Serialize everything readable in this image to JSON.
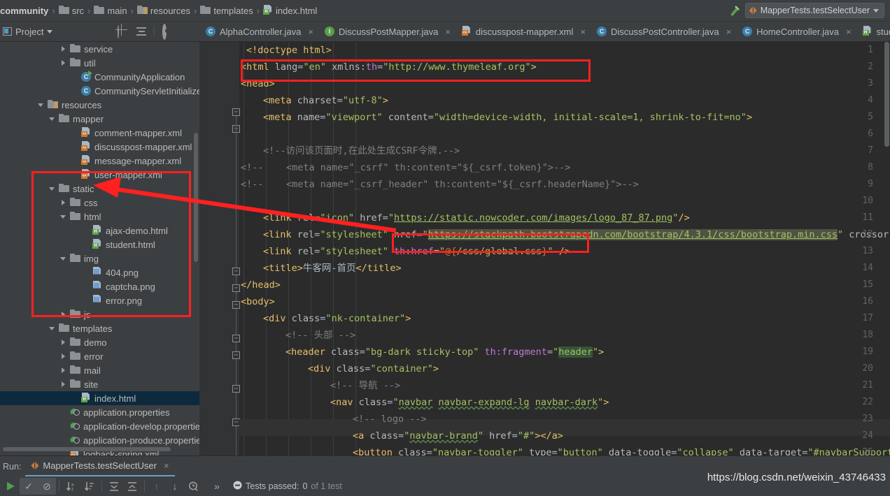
{
  "breadcrumb": {
    "items": [
      {
        "label": "community",
        "icon": "none",
        "bold": true
      },
      {
        "label": "src",
        "icon": "folder-icon"
      },
      {
        "label": "main",
        "icon": "folder-icon"
      },
      {
        "label": "resources",
        "icon": "resources-folder-icon"
      },
      {
        "label": "templates",
        "icon": "folder-icon"
      },
      {
        "label": "index.html",
        "icon": "html-file-icon"
      }
    ],
    "separator": "›"
  },
  "run_widget": {
    "hammer_tooltip": "make",
    "config_name": "MapperTests.testSelectUser",
    "caret": "▼"
  },
  "project_panel": {
    "title": "Project",
    "caret": "▼",
    "tools": [
      "locate-icon",
      "collapse-all-icon",
      "settings-gear-icon",
      "hide-icon"
    ]
  },
  "editor_tabs": [
    {
      "label": "AlphaController.java",
      "icon": "java-class-icon",
      "close": "×"
    },
    {
      "label": "DiscussPostMapper.java",
      "icon": "java-interface-icon",
      "close": "×"
    },
    {
      "label": "discusspost-mapper.xml",
      "icon": "xml-file-icon",
      "close": "×"
    },
    {
      "label": "DiscussPostController.java",
      "icon": "java-class-icon",
      "close": "×"
    },
    {
      "label": "HomeController.java",
      "icon": "java-class-icon",
      "close": "×"
    },
    {
      "label": "student",
      "icon": "html-file-icon",
      "close": "×"
    }
  ],
  "tree": [
    {
      "label": "service",
      "indent": 5,
      "arrow": "right",
      "icon": "folder-icon"
    },
    {
      "label": "util",
      "indent": 5,
      "arrow": "right",
      "icon": "folder-icon"
    },
    {
      "label": "CommunityApplication",
      "indent": 6,
      "arrow": "none",
      "icon": "spring-app-icon"
    },
    {
      "label": "CommunityServletInitializer",
      "indent": 6,
      "arrow": "none",
      "icon": "java-class-icon"
    },
    {
      "label": "resources",
      "indent": 3,
      "arrow": "down",
      "icon": "resources-folder-icon"
    },
    {
      "label": "mapper",
      "indent": 4,
      "arrow": "down",
      "icon": "folder-icon"
    },
    {
      "label": "comment-mapper.xml",
      "indent": 6,
      "arrow": "none",
      "icon": "xml-file-icon"
    },
    {
      "label": "discusspost-mapper.xml",
      "indent": 6,
      "arrow": "none",
      "icon": "xml-file-icon"
    },
    {
      "label": "message-mapper.xml",
      "indent": 6,
      "arrow": "none",
      "icon": "xml-file-icon"
    },
    {
      "label": "user-mapper.xml",
      "indent": 6,
      "arrow": "none",
      "icon": "xml-file-icon"
    },
    {
      "label": "static",
      "indent": 4,
      "arrow": "down",
      "icon": "folder-icon"
    },
    {
      "label": "css",
      "indent": 5,
      "arrow": "right",
      "icon": "folder-icon"
    },
    {
      "label": "html",
      "indent": 5,
      "arrow": "down",
      "icon": "folder-icon"
    },
    {
      "label": "ajax-demo.html",
      "indent": 7,
      "arrow": "none",
      "icon": "html-file-icon"
    },
    {
      "label": "student.html",
      "indent": 7,
      "arrow": "none",
      "icon": "html-file-icon"
    },
    {
      "label": "img",
      "indent": 5,
      "arrow": "down",
      "icon": "folder-icon"
    },
    {
      "label": "404.png",
      "indent": 7,
      "arrow": "none",
      "icon": "png-file-icon"
    },
    {
      "label": "captcha.png",
      "indent": 7,
      "arrow": "none",
      "icon": "png-file-icon"
    },
    {
      "label": "error.png",
      "indent": 7,
      "arrow": "none",
      "icon": "png-file-icon"
    },
    {
      "label": "js",
      "indent": 5,
      "arrow": "right",
      "icon": "folder-icon"
    },
    {
      "label": "templates",
      "indent": 4,
      "arrow": "down",
      "icon": "folder-icon"
    },
    {
      "label": "demo",
      "indent": 5,
      "arrow": "right",
      "icon": "folder-icon"
    },
    {
      "label": "error",
      "indent": 5,
      "arrow": "right",
      "icon": "folder-icon"
    },
    {
      "label": "mail",
      "indent": 5,
      "arrow": "right",
      "icon": "folder-icon"
    },
    {
      "label": "site",
      "indent": 5,
      "arrow": "right",
      "icon": "folder-icon"
    },
    {
      "label": "index.html",
      "indent": 6,
      "arrow": "none",
      "icon": "html-file-icon",
      "selected": true
    },
    {
      "label": "application.properties",
      "indent": 5,
      "arrow": "none",
      "icon": "properties-file-icon"
    },
    {
      "label": "application-develop.properties",
      "indent": 5,
      "arrow": "none",
      "icon": "properties-file-icon"
    },
    {
      "label": "application-produce.properties",
      "indent": 5,
      "arrow": "none",
      "icon": "properties-file-icon"
    },
    {
      "label": "logback-spring.xml",
      "indent": 5,
      "arrow": "none",
      "icon": "xml-file-icon"
    }
  ],
  "code_lines": [
    {
      "n": 1,
      "text": "<!doctype html>"
    },
    {
      "n": 2,
      "text": "<html lang=\"en\" xmlns:th=\"http://www.thymeleaf.org\">"
    },
    {
      "n": 3,
      "text": "<head>"
    },
    {
      "n": 4,
      "text": "    <meta charset=\"utf-8\">"
    },
    {
      "n": 5,
      "text": "    <meta name=\"viewport\" content=\"width=device-width, initial-scale=1, shrink-to-fit=no\">"
    },
    {
      "n": 6,
      "text": ""
    },
    {
      "n": 7,
      "text": "    <!--访问该页面时,在此处生成CSRF令牌.-->"
    },
    {
      "n": 8,
      "text": "<!--    <meta name=\"_csrf\" th:content=\"${_csrf.token}\">-->"
    },
    {
      "n": 9,
      "text": "<!--    <meta name=\"_csrf_header\" th:content=\"${_csrf.headerName}\">-->"
    },
    {
      "n": 10,
      "text": ""
    },
    {
      "n": 11,
      "text": "    <link rel=\"icon\" href=\"https://static.nowcoder.com/images/logo_87_87.png\"/>"
    },
    {
      "n": 12,
      "text": "    <link rel=\"stylesheet\" href=\"https://stackpath.bootstrapcdn.com/bootstrap/4.3.1/css/bootstrap.min.css\" crossor"
    },
    {
      "n": 13,
      "text": "    <link rel=\"stylesheet\" th:href=\"@{/css/global.css}\" />"
    },
    {
      "n": 14,
      "text": "    <title>牛客网-首页</title>"
    },
    {
      "n": 15,
      "text": "</head>"
    },
    {
      "n": 16,
      "text": "<body>"
    },
    {
      "n": 17,
      "text": "    <div class=\"nk-container\">"
    },
    {
      "n": 18,
      "text": "        <!-- 头部 -->"
    },
    {
      "n": 19,
      "text": "        <header class=\"bg-dark sticky-top\" th:fragment=\"header\">"
    },
    {
      "n": 20,
      "text": "            <div class=\"container\">"
    },
    {
      "n": 21,
      "text": "                <!-- 导航 -->"
    },
    {
      "n": 22,
      "text": "                <nav class=\"navbar navbar-expand-lg navbar-dark\">"
    },
    {
      "n": 23,
      "text": "                    <!-- logo -->"
    },
    {
      "n": 24,
      "text": "                    <a class=\"navbar-brand\" href=\"#\"></a>"
    },
    {
      "n": 25,
      "text": "                    <button class=\"navbar-toggler\" type=\"button\" data-toggle=\"collapse\" data-target=\"#navbarSupport"
    }
  ],
  "annotations": {
    "box_html_line": "highlights <html lang=\"en\" xmlns:th=\"http://www.thymeleaf.org\">",
    "box_thhref_line": "highlights th:href=\"@{/css/global.css}\"",
    "box_static_tree": "highlights static folder subtree",
    "arrow_color": "#ff2020"
  },
  "run_panel": {
    "run_word": "Run:",
    "tab_label": "MapperTests.testSelectUser",
    "tab_close": "×",
    "toolbar": [
      "rerun-icon",
      "show-passed-icon",
      "dim-passed-icon",
      "sort-alpha-icon",
      "sort-duration-icon",
      "expand-all-icon",
      "collapse-all-icon",
      "prev-failed-icon",
      "next-failed-icon",
      "test-history-icon"
    ],
    "overflow": "»",
    "status_prefix": "Tests passed: ",
    "status_count": "0",
    "status_suffix": " of 1 test"
  },
  "watermark": "https://blog.csdn.net/weixin_43746433",
  "colors": {
    "window_bg": "#3c3f41",
    "editor_bg": "#2b2b2b",
    "gutter_bg": "#313335",
    "selection_blue": "#0d293e",
    "annotation_red": "#ff2020",
    "tag_orange": "#e8bf6a",
    "string_green": "#a5c261",
    "comment_gray": "#808080",
    "thymeleaf_purple": "#bf7ad1"
  }
}
